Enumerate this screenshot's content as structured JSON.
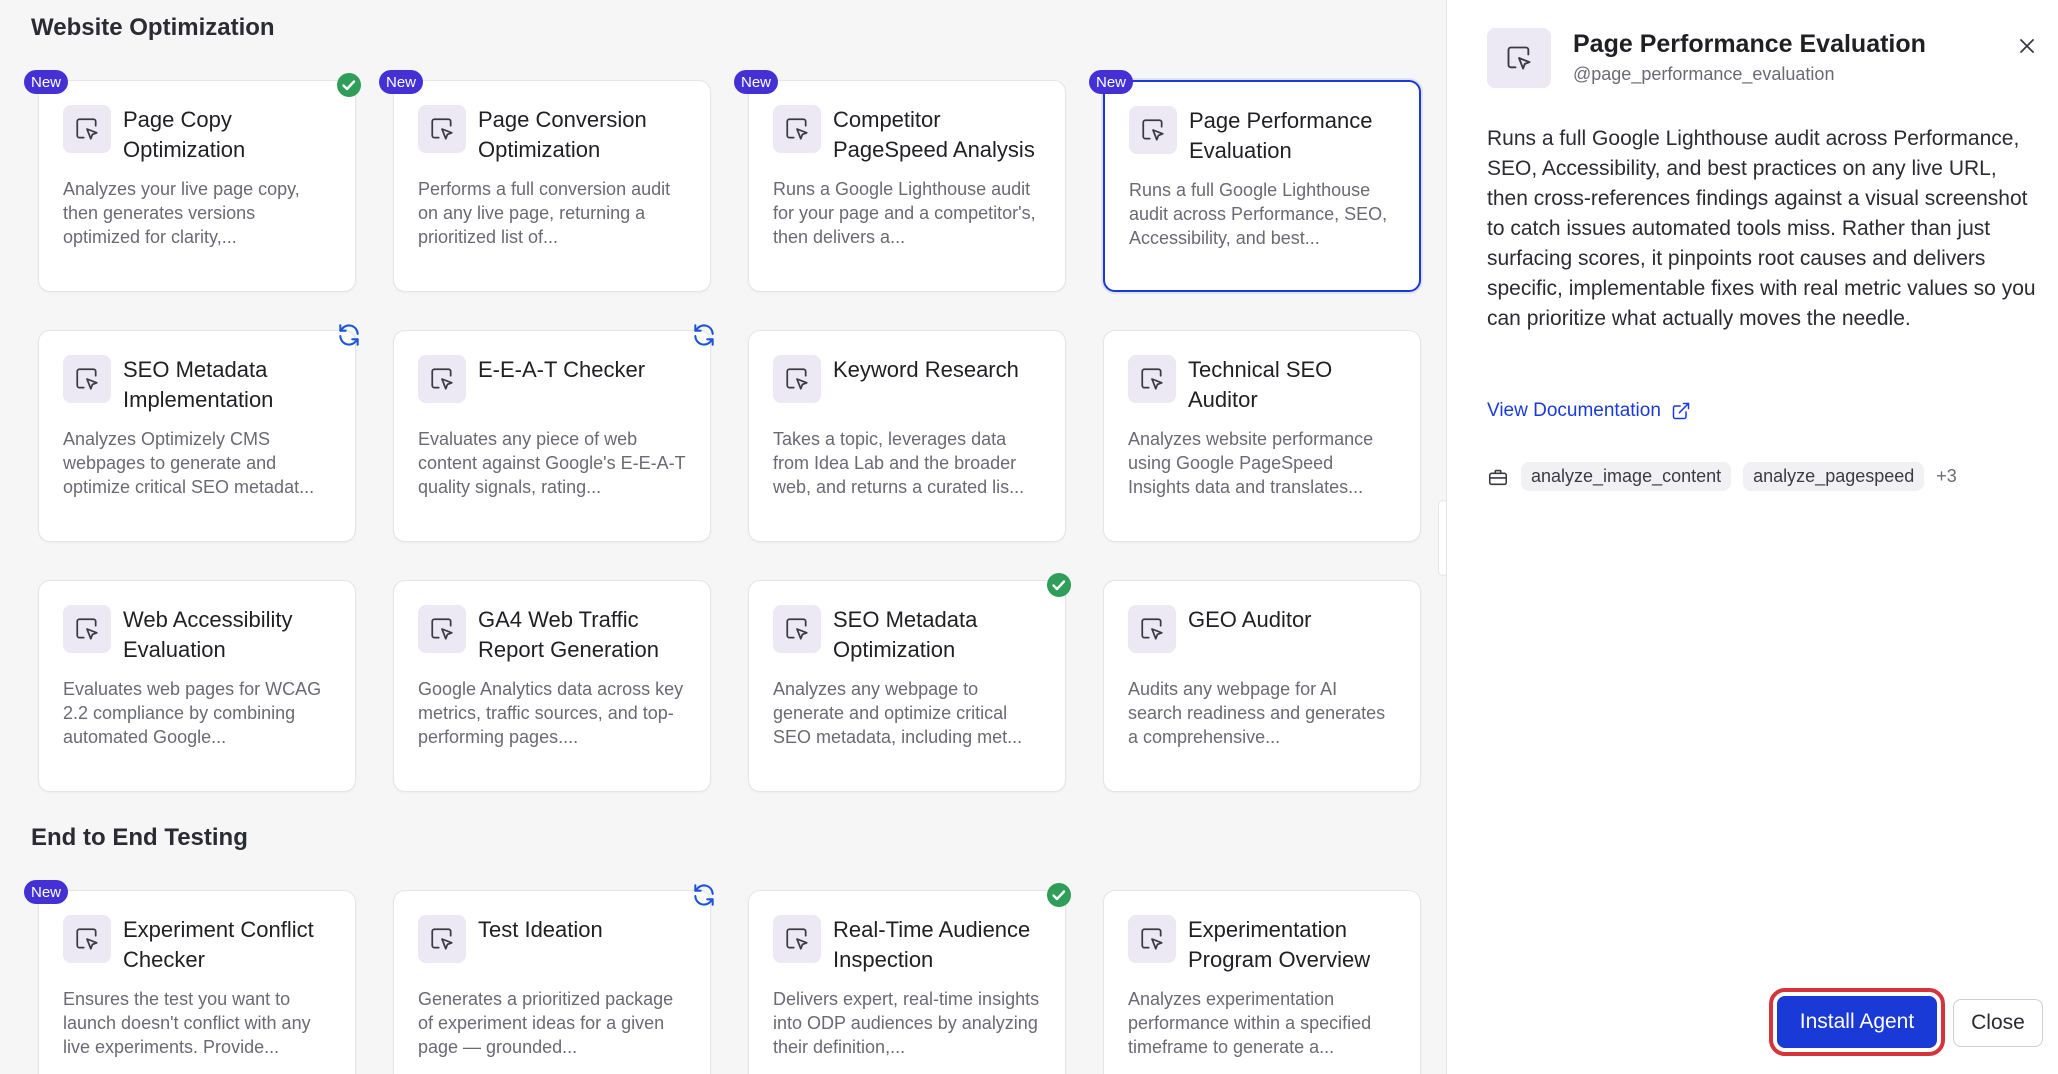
{
  "sections": [
    {
      "title": "Website Optimization",
      "cards": [
        {
          "title": "Page Copy Optimization",
          "desc": "Analyzes your live page copy, then generates versions optimized for clarity,...",
          "new": true,
          "status": "installed"
        },
        {
          "title": "Page Conversion Optimization",
          "desc": "Performs a full conversion audit on any live page, returning a prioritized list of...",
          "new": true,
          "status": ""
        },
        {
          "title": "Competitor PageSpeed Analysis",
          "desc": "Runs a Google Lighthouse audit for your page and a competitor's, then delivers a...",
          "new": true,
          "status": ""
        },
        {
          "title": "Page Performance Evaluation",
          "desc": "Runs a full Google Lighthouse audit across Performance, SEO, Accessibility, and best...",
          "new": true,
          "status": "",
          "selected": true
        },
        {
          "title": "SEO Metadata Implementation",
          "desc": "Analyzes Optimizely CMS webpages to generate and optimize critical SEO metadat...",
          "new": false,
          "status": "update"
        },
        {
          "title": "E-E-A-T Checker",
          "desc": "Evaluates any piece of web content against Google's E-E-A-T quality signals, rating...",
          "new": false,
          "status": "update"
        },
        {
          "title": "Keyword Research",
          "desc": "Takes a topic, leverages data from Idea Lab and the broader web, and returns a curated lis...",
          "new": false,
          "status": ""
        },
        {
          "title": "Technical SEO Auditor",
          "desc": "Analyzes website performance using Google PageSpeed Insights data and translates...",
          "new": false,
          "status": ""
        },
        {
          "title": "Web Accessibility Evaluation",
          "desc": "Evaluates web pages for WCAG 2.2 compliance by combining automated Google...",
          "new": false,
          "status": ""
        },
        {
          "title": "GA4 Web Traffic Report Generation",
          "desc": "Google Analytics data across key metrics, traffic sources, and top-performing pages....",
          "new": false,
          "status": ""
        },
        {
          "title": "SEO Metadata Optimization",
          "desc": "Analyzes any webpage to generate and optimize critical SEO metadata, including met...",
          "new": false,
          "status": "installed"
        },
        {
          "title": "GEO Auditor",
          "desc": "Audits any webpage for AI search readiness and generates a comprehensive...",
          "new": false,
          "status": ""
        }
      ]
    },
    {
      "title": "End to End Testing",
      "cards": [
        {
          "title": "Experiment Conflict Checker",
          "desc": "Ensures the test you want to launch doesn't conflict with any live experiments. Provide...",
          "new": true,
          "status": ""
        },
        {
          "title": "Test Ideation",
          "desc": "Generates a prioritized package of experiment ideas for a given page — grounded...",
          "new": false,
          "status": "update"
        },
        {
          "title": "Real-Time Audience Inspection",
          "desc": "Delivers expert, real-time insights into ODP audiences by analyzing their definition,...",
          "new": false,
          "status": "installed"
        },
        {
          "title": "Experimentation Program Overview",
          "desc": "Analyzes experimentation performance within a specified timeframe to generate a...",
          "new": false,
          "status": ""
        }
      ]
    }
  ],
  "badge_new_label": "New",
  "panel": {
    "title": "Page Performance Evaluation",
    "handle": "@page_performance_evaluation",
    "description": "Runs a full Google Lighthouse audit across Performance, SEO, Accessibility, and best practices on any live URL, then cross-references findings against a visual screenshot to catch issues automated tools miss. Rather than just surfacing scores, it pinpoints root causes and delivers specific, implementable fixes with real metric values so you can prioritize what actually moves the needle.",
    "doc_link": "View Documentation",
    "tools": [
      "analyze_image_content",
      "analyze_pagespeed"
    ],
    "tools_more": "+3",
    "install_label": "Install Agent",
    "close_label": "Close"
  },
  "colors": {
    "accent": "#1a3ad8",
    "badge_new": "#4331d6",
    "installed_green": "#2e9e58",
    "update_blue": "#1a56db",
    "highlight_red": "#d7333a"
  },
  "icons": {
    "agent": "cursor-click-icon",
    "installed": "check-circle-icon",
    "update": "refresh-icon",
    "close": "close-icon",
    "external": "external-link-icon",
    "tools": "toolbox-icon"
  }
}
